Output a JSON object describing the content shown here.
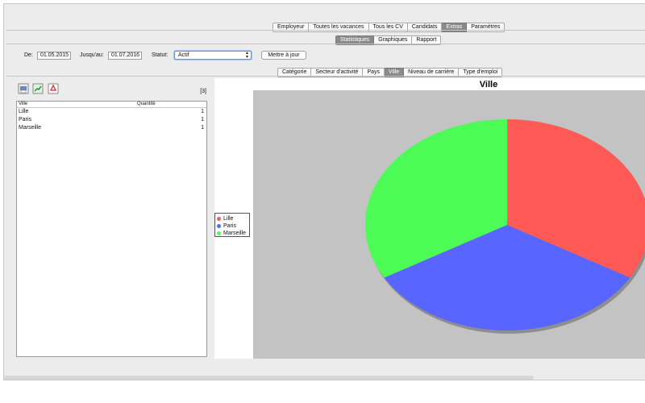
{
  "top_tabs": [
    "Employeur",
    "Toutes les vacances",
    "Tous les CV",
    "Candidats",
    "Extras",
    "Paramètres"
  ],
  "top_tabs_selected": 4,
  "sub_tabs": [
    "Statistiques",
    "Graphiques",
    "Rapport"
  ],
  "sub_tabs_selected": 0,
  "filters": {
    "from_label": "De:",
    "from_value": "01.05.2015",
    "to_label": "Jusqu'au:",
    "to_value": "01.07.2016",
    "status_label": "Statut:",
    "status_value": "Actif",
    "update_button": "Mettre à jour"
  },
  "category_tabs": [
    "Catégorie",
    "Secteur d'activité",
    "Pays",
    "Ville",
    "Niveau de carrière",
    "Type d'emploi"
  ],
  "category_tabs_selected": 3,
  "export_icons": [
    "print-icon",
    "excel-export-icon",
    "pdf-export-icon"
  ],
  "row_count": "[3]",
  "table": {
    "columns": [
      "Ville",
      "Quantité"
    ],
    "rows": [
      {
        "city": "Lille",
        "qty": "1"
      },
      {
        "city": "Paris",
        "qty": "1"
      },
      {
        "city": "Marseille",
        "qty": "1"
      }
    ]
  },
  "colors": {
    "lille": "#ff5a55",
    "paris": "#5865ff",
    "marseille": "#4dfb57",
    "plot_bg": "#c3c3c3",
    "selected_tab": "#8a8a8a"
  },
  "chart_data": {
    "type": "pie",
    "title": "Ville",
    "categories": [
      "Lille",
      "Paris",
      "Marseille"
    ],
    "values": [
      1,
      1,
      1
    ],
    "legend_position": "left"
  }
}
